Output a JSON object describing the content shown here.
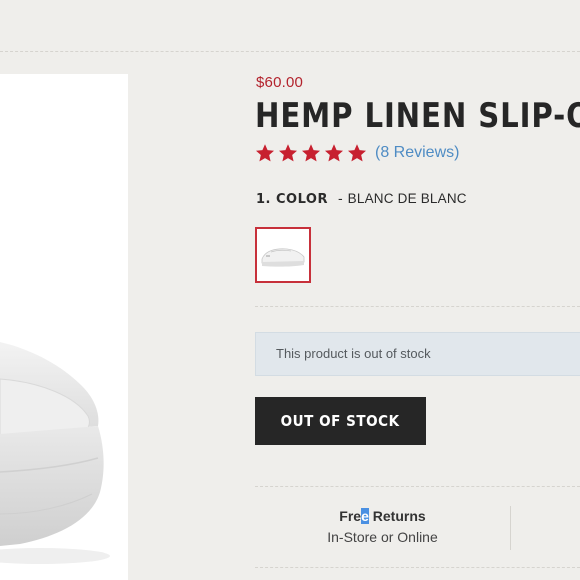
{
  "product": {
    "price": "$60.00",
    "title": "HEMP LINEN SLIP-O",
    "rating": 5,
    "reviews_label": "(8 Reviews)",
    "rating_color": "#c7202f"
  },
  "color_selector": {
    "label": "1. COLOR",
    "separator": "-",
    "value": "BLANC DE BLANC",
    "swatch_icon": "shoe-thumbnail",
    "selected_border_color": "#c7303a"
  },
  "stock": {
    "notice": "This product is out of stock",
    "button_label": "OUT OF STOCK"
  },
  "returns": {
    "heading_start": "Fre",
    "heading_highlight": "e",
    "heading_end": " Returns",
    "subtext": "In-Store or Online"
  },
  "colors": {
    "price": "#b3232d",
    "link": "#4f8cc4",
    "button_bg": "#262626",
    "notice_bg": "#e1e7ec",
    "page_bg": "#efeeeb"
  }
}
